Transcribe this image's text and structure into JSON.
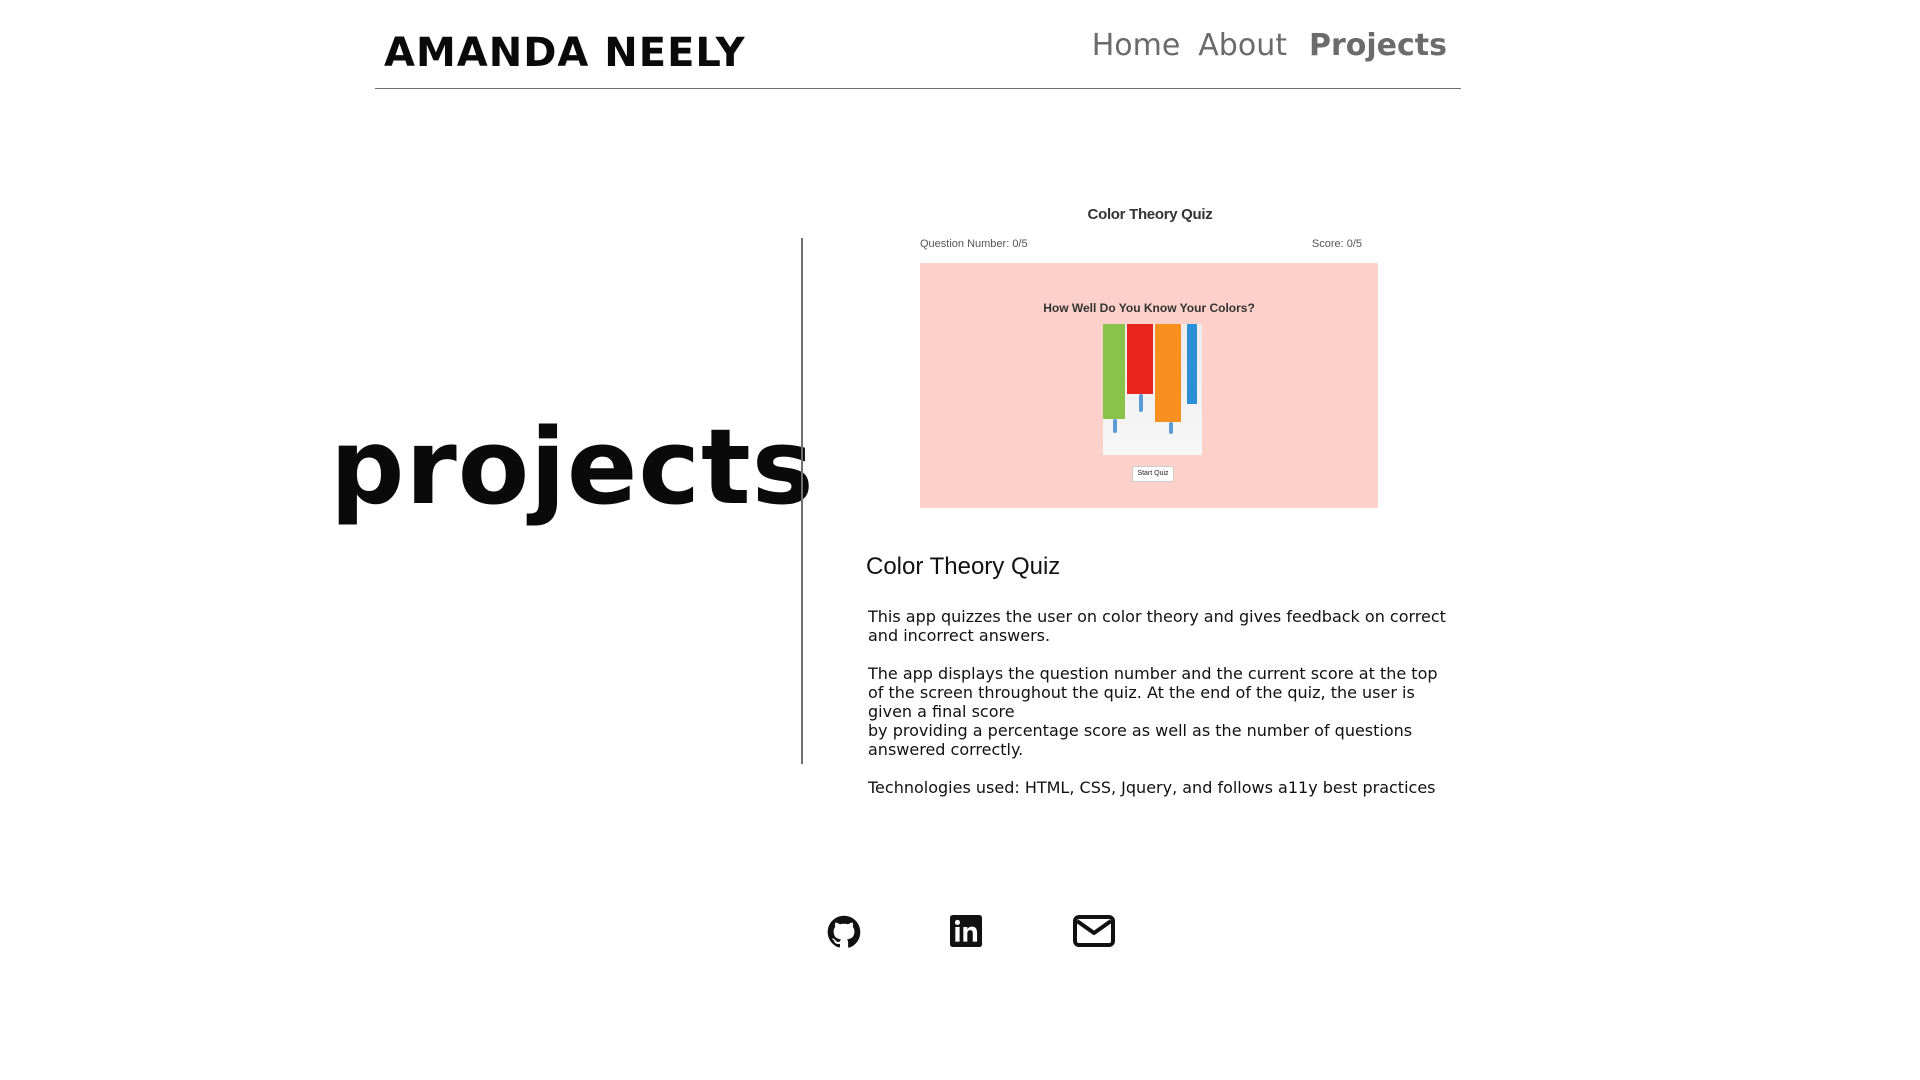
{
  "header": {
    "brand": "AMANDA NEELY",
    "nav": [
      {
        "label": "Home"
      },
      {
        "label": "About"
      },
      {
        "label": "Projects"
      }
    ]
  },
  "hero": {
    "title": "projects"
  },
  "project": {
    "screenshot": {
      "title": "Color Theory Quiz",
      "question_number": "Question Number: 0/5",
      "score": "Score: 0/5",
      "question": "How Well Do You Know Your Colors?",
      "button_label": "Start Quiz",
      "card_color": "#fdd1c9"
    },
    "name": "Color Theory Quiz",
    "description_1_lines": [
      "This app quizzes the user on color theory and gives feedback on correct",
      "and incorrect answers."
    ],
    "description_2_lines": [
      "The app displays the question number and the current score at the top",
      "of the screen throughout the quiz. At the end of the quiz, the user is",
      "given a final score",
      "by providing a percentage score as well as the number of questions",
      "answered correctly."
    ],
    "technologies": "Technologies used: HTML, CSS, Jquery, and follows a11y best practices"
  },
  "footer": {
    "icons": [
      "github-icon",
      "linkedin-icon",
      "mail-icon"
    ]
  }
}
